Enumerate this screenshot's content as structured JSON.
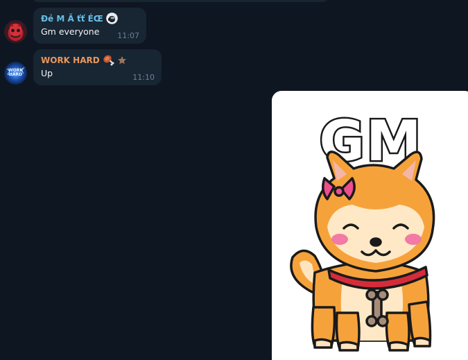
{
  "colors": {
    "background": "#0e1621",
    "bubble": "#182533",
    "sender1": "#67bde4",
    "sender2": "#e9985c",
    "time": "#6d8197"
  },
  "messages": [
    {
      "sender": "Đẻ M Ă ťť ÉŒ",
      "sender_icon": "among-us-crewmate-icon",
      "text": "Gm everyone",
      "time": "11:07",
      "avatar": "red-cartoon-avatar"
    },
    {
      "sender": "WORK HARD",
      "sender_icons": [
        "meat-on-bone-icon",
        "star-icon"
      ],
      "text": "Up",
      "time": "11:10",
      "avatar": "work-hard-logo-avatar",
      "avatar_text": "WORK HARD"
    }
  ],
  "sticker": {
    "text": "GM",
    "description_icon": "shiba-dog-sticker"
  }
}
